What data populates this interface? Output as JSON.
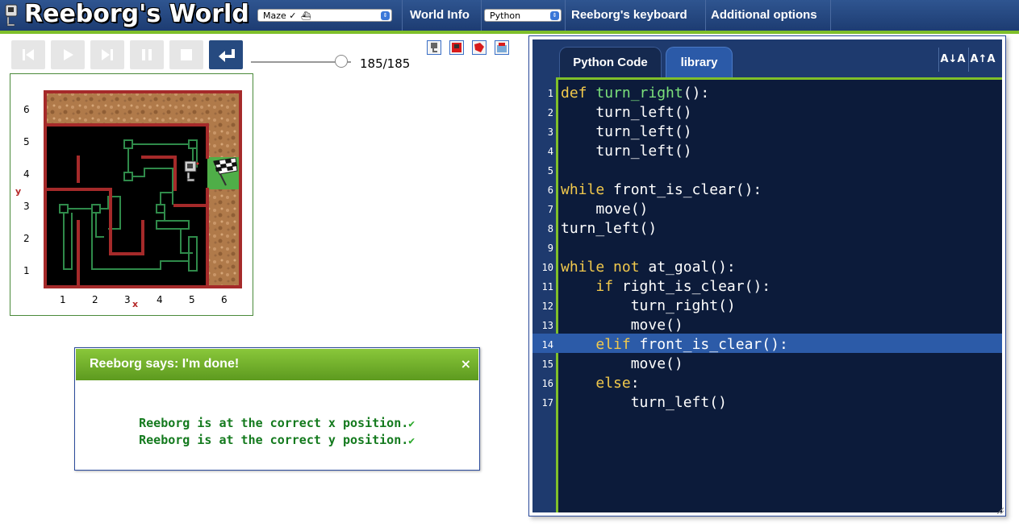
{
  "app": {
    "title": "Reeborg's World"
  },
  "topbar": {
    "world_select": "Maze ✓",
    "language_select": "Python",
    "world_info": "World Info",
    "keyboard": "Reeborg's keyboard",
    "options": "Additional options"
  },
  "controls": {
    "steps": "185/185",
    "speed_fraction": 0.9
  },
  "world": {
    "x_ticks": [
      "1",
      "2",
      "3",
      "4",
      "5",
      "6"
    ],
    "y_ticks": [
      "6",
      "5",
      "4",
      "3",
      "2",
      "1"
    ],
    "x_name": "x",
    "y_name": "y"
  },
  "dialog": {
    "title": "Reeborg says: I'm done!",
    "close": "×",
    "lines": [
      "Reeborg is at the correct x position.",
      "Reeborg is at the correct y position."
    ],
    "check": "✔"
  },
  "editor": {
    "tabs": [
      "Python Code",
      "library"
    ],
    "font_smaller": "A↓A",
    "font_larger": "A↑A",
    "highlight_line": 14,
    "lines": [
      [
        [
          "def",
          "kw"
        ],
        [
          " ",
          ""
        ],
        [
          "turn_right",
          "fn"
        ],
        [
          "():",
          ""
        ]
      ],
      [
        [
          "    turn_left()",
          ""
        ]
      ],
      [
        [
          "    turn_left()",
          ""
        ]
      ],
      [
        [
          "    turn_left()",
          ""
        ]
      ],
      [],
      [
        [
          "while",
          "kw"
        ],
        [
          " front_is_clear():",
          ""
        ]
      ],
      [
        [
          "    move()",
          ""
        ]
      ],
      [
        [
          "turn_left()",
          ""
        ]
      ],
      [],
      [
        [
          "while",
          "kw"
        ],
        [
          " ",
          ""
        ],
        [
          "not",
          "kw"
        ],
        [
          " at_goal():",
          ""
        ]
      ],
      [
        [
          "    ",
          ""
        ],
        [
          "if",
          "kw"
        ],
        [
          " right_is_clear():",
          ""
        ]
      ],
      [
        [
          "        turn_right()",
          ""
        ]
      ],
      [
        [
          "        move()",
          ""
        ]
      ],
      [
        [
          "    ",
          ""
        ],
        [
          "elif",
          "kw"
        ],
        [
          " front_is_clear():",
          ""
        ]
      ],
      [
        [
          "        move()",
          ""
        ]
      ],
      [
        [
          "    ",
          ""
        ],
        [
          "else",
          "kw"
        ],
        [
          ":",
          ""
        ]
      ],
      [
        [
          "        turn_left()",
          ""
        ]
      ]
    ]
  }
}
